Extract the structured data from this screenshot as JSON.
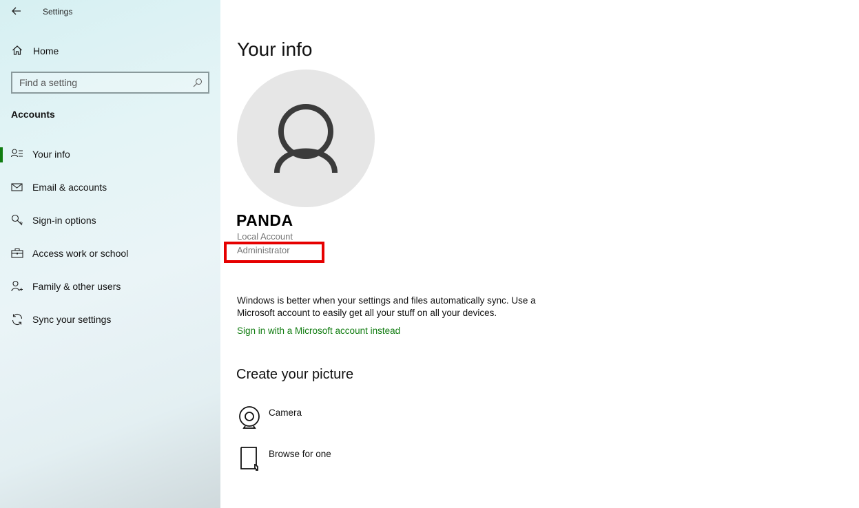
{
  "window": {
    "title": "Settings"
  },
  "sidebar": {
    "home_label": "Home",
    "search": {
      "placeholder": "Find a setting",
      "value": ""
    },
    "section_title": "Accounts",
    "selected_index": 0,
    "accent_color": "#107c10",
    "items": [
      {
        "label": "Your info",
        "icon": "person-list-icon"
      },
      {
        "label": "Email & accounts",
        "icon": "mail-icon"
      },
      {
        "label": "Sign-in options",
        "icon": "key-icon"
      },
      {
        "label": "Access work or school",
        "icon": "briefcase-icon"
      },
      {
        "label": "Family & other users",
        "icon": "person-add-icon"
      },
      {
        "label": "Sync your settings",
        "icon": "sync-icon"
      }
    ]
  },
  "main": {
    "page_title": "Your info",
    "user": {
      "name": "PANDA",
      "account_type": "Local Account",
      "role": "Administrator"
    },
    "sync_text": "Windows is better when your settings and files automatically sync. Use a Microsoft account to easily get all your stuff on all your devices.",
    "sync_link": "Sign in with a Microsoft account instead",
    "picture_section_title": "Create your picture",
    "picture_options": [
      {
        "label": "Camera",
        "icon": "camera-icon"
      },
      {
        "label": "Browse for one",
        "icon": "browse-file-icon"
      }
    ],
    "highlight_color": "#e60000"
  }
}
